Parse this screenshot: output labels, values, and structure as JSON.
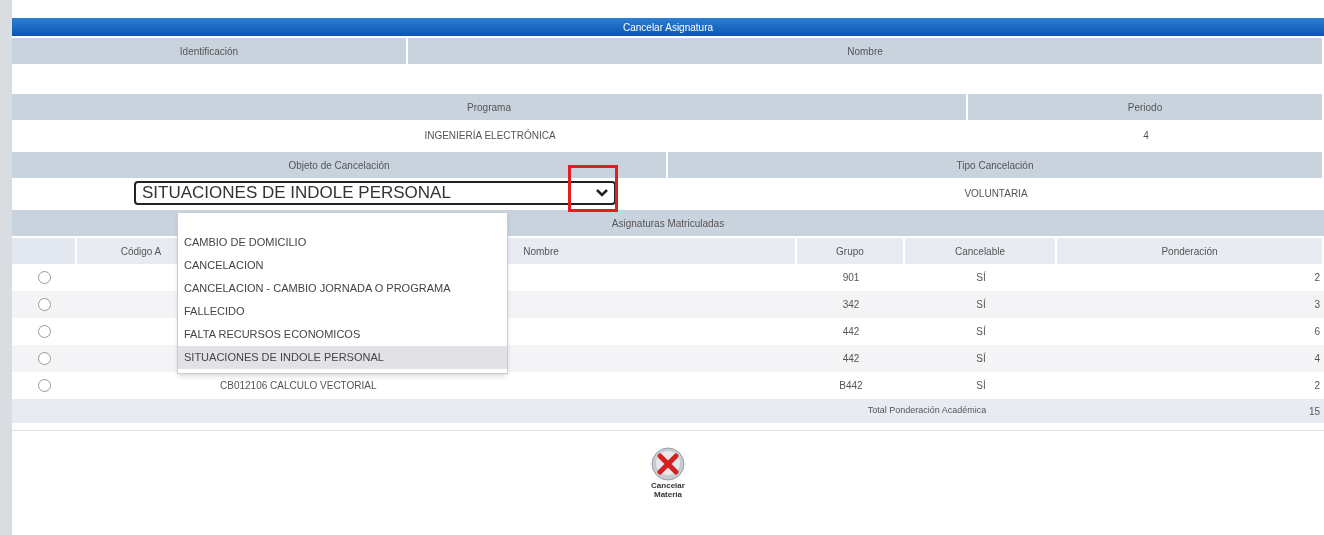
{
  "title": "Cancelar Asignatura",
  "student": {
    "headers": [
      "Identificación",
      "Nombre"
    ]
  },
  "program": {
    "headers": [
      "Programa",
      "Periodo"
    ],
    "values": [
      "INGENIERÍA ELECTRÓNICA",
      "4"
    ]
  },
  "cancellation": {
    "headers": [
      "Objeto de Cancelación",
      "Tipo Cancelación"
    ],
    "select_value": "SITUACIONES DE INDOLE PERSONAL",
    "type_value": "VOLUNTARIA",
    "options": [
      {
        "label": "CAMBIO DE DOMICILIO",
        "selected": false
      },
      {
        "label": "CANCELACION",
        "selected": false
      },
      {
        "label": "CANCELACION - CAMBIO JORNADA O PROGRAMA",
        "selected": false
      },
      {
        "label": "FALLECIDO",
        "selected": false
      },
      {
        "label": "FALTA RECURSOS ECONOMICOS",
        "selected": false
      },
      {
        "label": "SITUACIONES DE INDOLE PERSONAL",
        "selected": true
      }
    ]
  },
  "subjects": {
    "title": "Asignaturas Matriculadas",
    "columns": [
      "Código A",
      "Nombre",
      "Grupo",
      "Cancelable",
      "Ponderación"
    ],
    "rows": [
      {
        "selected": false,
        "grupo": "901",
        "cancelable": "SÍ",
        "ponderacion": "2"
      },
      {
        "selected": false,
        "grupo": "342",
        "cancelable": "SÍ",
        "ponderacion": "3"
      },
      {
        "selected": false,
        "grupo": "442",
        "cancelable": "SÍ",
        "ponderacion": "6"
      },
      {
        "selected": false,
        "grupo": "442",
        "cancelable": "SÍ",
        "ponderacion": "4"
      },
      {
        "selected": false,
        "subject": "CB012106 CALCULO VECTORIAL",
        "grupo": "B442",
        "cancelable": "SÍ",
        "ponderacion": "2"
      }
    ],
    "total_label": "Total Ponderación Académica",
    "total_value": "15"
  },
  "action_button": {
    "label": "Cancelar Materia"
  }
}
